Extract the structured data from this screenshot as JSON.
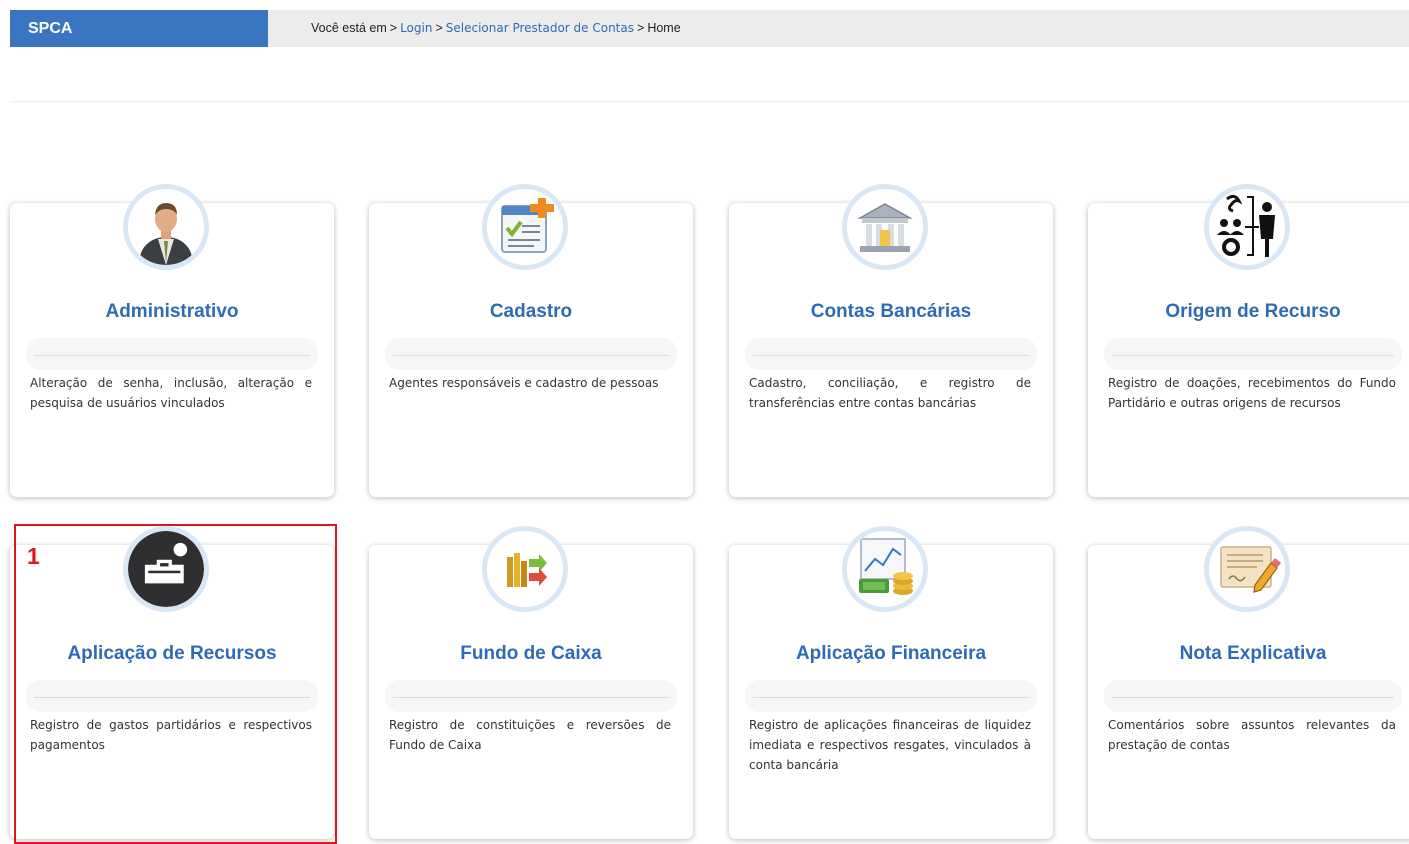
{
  "app": {
    "brand": "SPCA"
  },
  "breadcrumb": {
    "prefix": "Você está em",
    "items": [
      "Login",
      "Selecionar Prestador de Contas",
      "Home"
    ]
  },
  "annotation": {
    "number": "1"
  },
  "cards": [
    {
      "icon": "businessman-icon",
      "title": "Administrativo",
      "description": "Alteração de senha, inclusão, alteração e pesquisa de usuários vinculados"
    },
    {
      "icon": "form-checklist-icon",
      "title": "Cadastro",
      "description": "Agentes responsáveis e cadastro de pessoas"
    },
    {
      "icon": "bank-icon",
      "title": "Contas Bancárias",
      "description": "Cadastro, conciliação, e registro de transferências entre contas bancárias"
    },
    {
      "icon": "resource-origin-icon",
      "title": "Origem de Recurso",
      "description": "Registro de doações, recebimentos do Fundo Partidário e outras origens de recursos"
    },
    {
      "icon": "toolbox-icon",
      "title": "Aplicação de Recursos",
      "description": "Registro de gastos partidários e respectivos pagamentos"
    },
    {
      "icon": "cash-fund-icon",
      "title": "Fundo de Caixa",
      "description": "Registro de constituições e reversões de Fundo de Caixa"
    },
    {
      "icon": "financial-chart-icon",
      "title": "Aplicação Financeira",
      "description": "Registro de aplicações financeiras de liquidez imediata e respectivos resgates, vinculados à conta bancária"
    },
    {
      "icon": "note-pencil-icon",
      "title": "Nota Explicativa",
      "description": "Comentários sobre assuntos relevantes da prestação de contas"
    }
  ],
  "colors": {
    "brand": "#3a76bf",
    "title": "#2f6bb5",
    "highlight": "#d71920"
  }
}
